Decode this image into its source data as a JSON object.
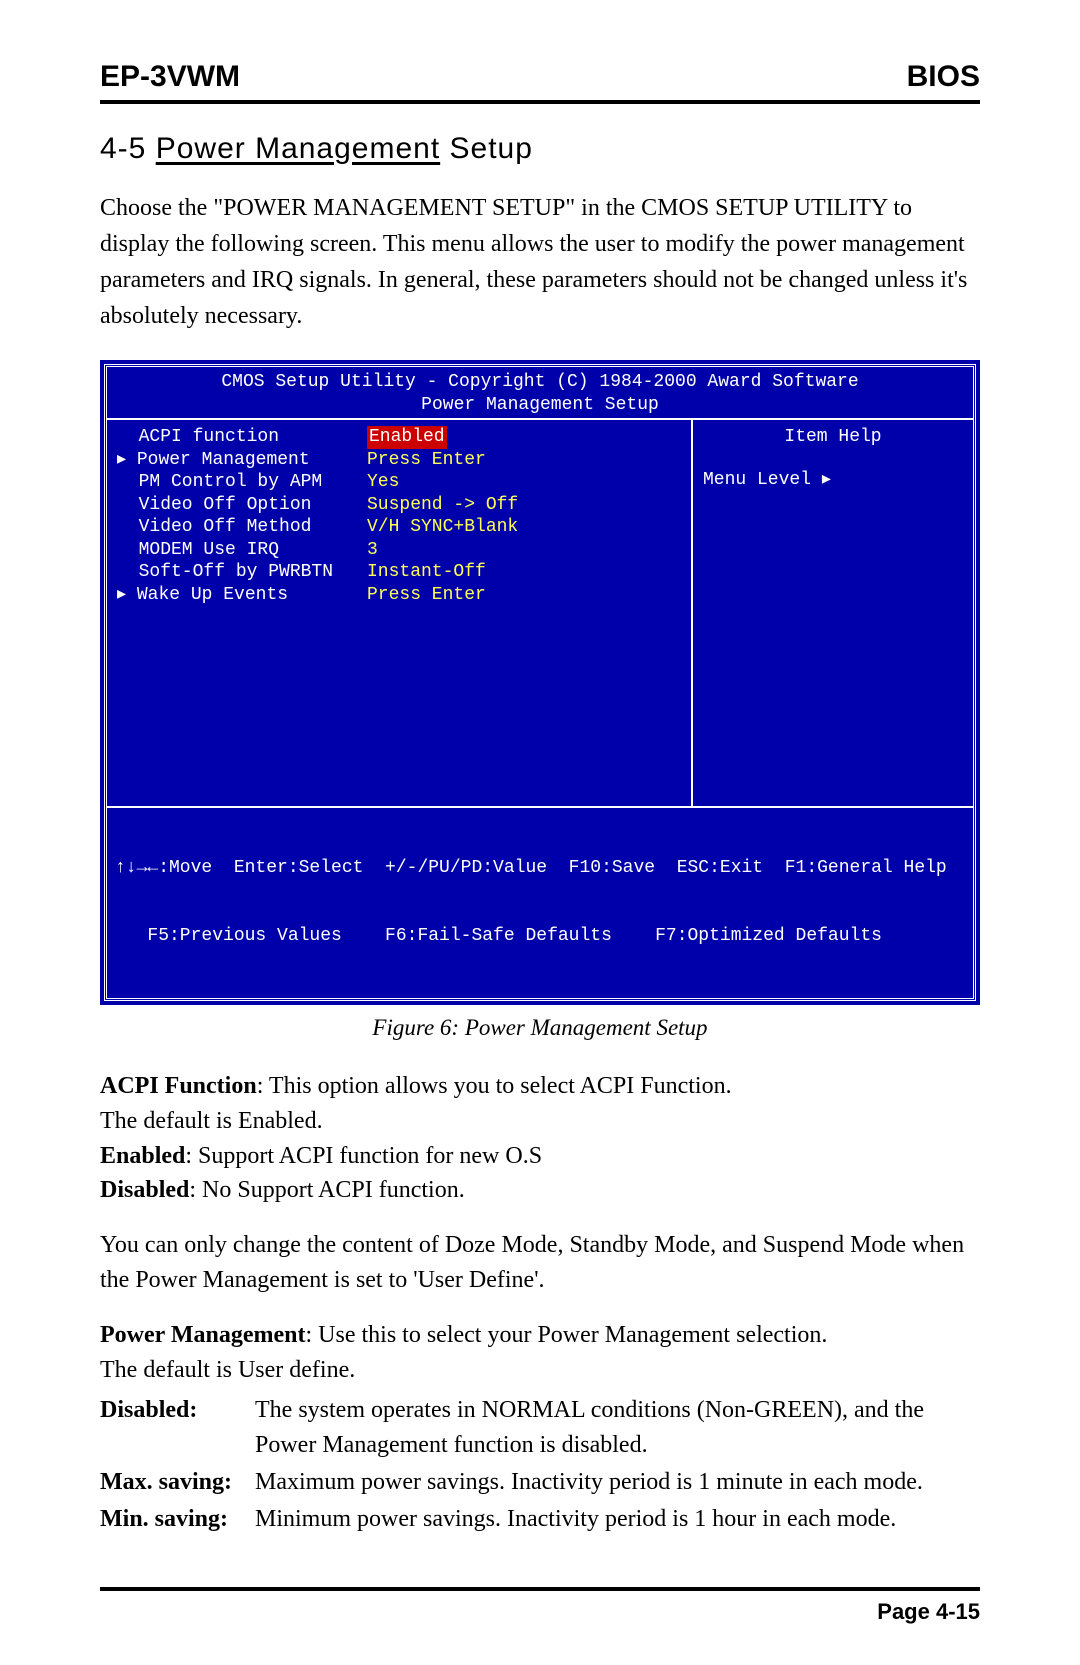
{
  "header": {
    "left": "EP-3VWM",
    "right": "BIOS"
  },
  "section": {
    "number": "4-5 ",
    "title_underlined": "Power Management",
    "title_rest": " Setup"
  },
  "intro": "Choose the \"POWER MANAGEMENT SETUP\" in the CMOS SETUP UTILITY to display the following screen. This menu allows the user to modify the power management parameters and IRQ signals. In general, these parameters should not be changed unless it's absolutely necessary.",
  "bios": {
    "title1": "CMOS Setup Utility - Copyright (C) 1984-2000 Award Software",
    "title2": "Power Management Setup",
    "items": [
      {
        "label": "  ACPI function",
        "value": "Enabled",
        "selected": true
      },
      {
        "label": "▸ Power Management",
        "value": "Press Enter",
        "selected": false
      },
      {
        "label": "  PM Control by APM",
        "value": "Yes",
        "selected": false
      },
      {
        "label": "  Video Off Option",
        "value": "Suspend -> Off",
        "selected": false
      },
      {
        "label": "  Video Off Method",
        "value": "V/H SYNC+Blank",
        "selected": false
      },
      {
        "label": "  MODEM Use IRQ",
        "value": "3",
        "selected": false
      },
      {
        "label": "  Soft-Off by PWRBTN",
        "value": "Instant-Off",
        "selected": false
      },
      {
        "label": "▸ Wake Up Events",
        "value": "Press Enter",
        "selected": false
      }
    ],
    "help_title": "Item Help",
    "menu_level": "Menu Level   ▸",
    "footer1": "↑↓→←:Move  Enter:Select  +/-/PU/PD:Value  F10:Save  ESC:Exit  F1:General Help",
    "footer2": "   F5:Previous Values    F6:Fail-Safe Defaults    F7:Optimized Defaults"
  },
  "figure_caption": "Figure 6:  Power Management Setup",
  "acpi": {
    "label": "ACPI Function",
    "text": ": This option allows you to select ACPI Function.",
    "default": "The default is Enabled.",
    "enabled_label": "Enabled",
    "enabled_text": ":  Support ACPI function for new O.S",
    "disabled_label": "Disabled",
    "disabled_text": ": No Support ACPI function."
  },
  "note": "You can only change the content of Doze Mode, Standby Mode, and Suspend Mode when the Power Management is set to 'User Define'.",
  "pm": {
    "label": "Power Management",
    "text": ": Use this to select your Power Management selection.",
    "default": "The default is User define."
  },
  "defs": [
    {
      "term": "Disabled:",
      "desc": "The system operates in NORMAL conditions (Non-GREEN), and the Power Management function is disabled."
    },
    {
      "term": "Max. saving:",
      "desc": "Maximum power savings. Inactivity period is 1 minute in each mode."
    },
    {
      "term": "Min. saving:",
      "desc": "Minimum power savings. Inactivity period is 1 hour in each mode."
    }
  ],
  "page_footer": "Page 4-15"
}
